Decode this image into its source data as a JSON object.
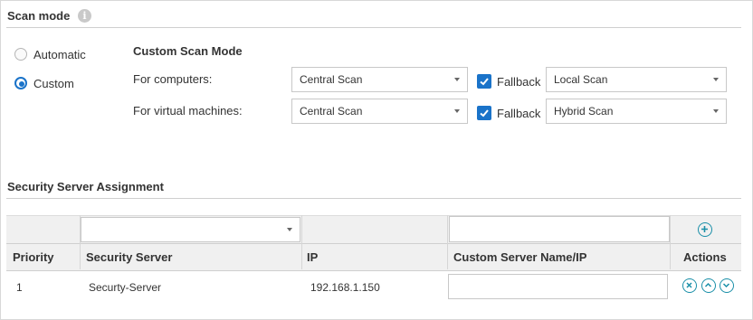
{
  "scan_mode": {
    "title": "Scan mode",
    "info_icon": "info-icon",
    "options": [
      {
        "label": "Automatic",
        "selected": false
      },
      {
        "label": "Custom",
        "selected": true
      }
    ],
    "custom": {
      "heading": "Custom Scan Mode",
      "rows": [
        {
          "label": "For computers:",
          "scan_value": "Central Scan",
          "fallback_label": "Fallback",
          "fallback_checked": true,
          "fallback_value": "Local Scan"
        },
        {
          "label": "For virtual machines:",
          "scan_value": "Central Scan",
          "fallback_label": "Fallback",
          "fallback_checked": true,
          "fallback_value": "Hybrid Scan"
        }
      ]
    }
  },
  "assignment": {
    "title": "Security Server Assignment",
    "filter": {
      "server_select_value": "",
      "custom_name_value": ""
    },
    "columns": [
      "Priority",
      "Security Server",
      "IP",
      "Custom Server Name/IP",
      "Actions"
    ],
    "rows": [
      {
        "priority": "1",
        "server": "Securty-Server",
        "ip": "192.168.1.150",
        "custom": ""
      }
    ],
    "colors": {
      "accent": "#1a73c9",
      "action": "#1a8fa8"
    }
  }
}
